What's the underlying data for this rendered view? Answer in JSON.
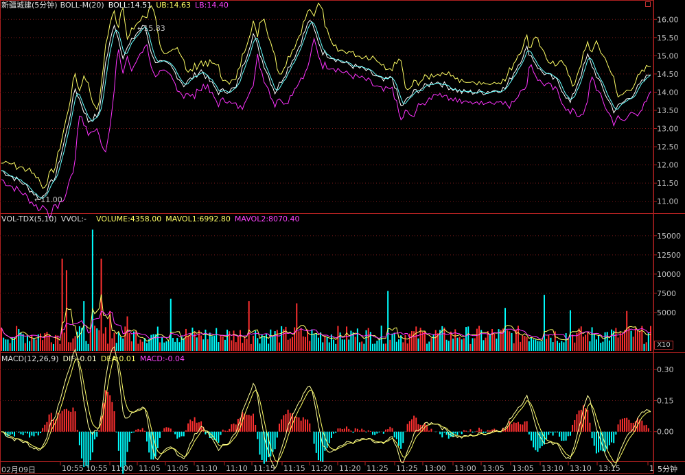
{
  "colors": {
    "bg": "#000000",
    "frame": "#b02020",
    "grid": "#7a1a1a",
    "price": "#ffffff",
    "boll_mid": "#ffffff",
    "ub": "#ffff66",
    "lb": "#ff33ff",
    "ma": "#66ffff",
    "up": "#ff3030",
    "down": "#00ffff",
    "vol_ma1": "#ffff66",
    "vol_ma2": "#ff33ff",
    "dif": "#ffff99",
    "text": "#c0c0c0"
  },
  "main_panel": {
    "title": "新疆城建(5分钟)",
    "indicator": "BOLL-M(20)",
    "boll": "BOLL:14.51",
    "ub": "UB:14.63",
    "lb": "LB:14.40",
    "y_ticks": [
      "16.00",
      "15.50",
      "15.00",
      "14.50",
      "14.00",
      "13.50",
      "13.00",
      "12.50",
      "12.00",
      "11.50",
      "11.00"
    ],
    "annotation_high": "15.83",
    "annotation_low": "11.00"
  },
  "vol_panel": {
    "title": "VOL-TDX(5,10)",
    "vvol": "VVOL:-",
    "volume": "VOLUME:4358.00",
    "mavol1": "MAVOL1:6992.80",
    "mavol2": "MAVOL2:8070.40",
    "y_ticks": [
      "15000",
      "12500",
      "10000",
      "7500",
      "5000"
    ],
    "unit": "X10"
  },
  "macd_panel": {
    "title": "MACD(12,26,9)",
    "dif": "DIF:-0.01",
    "dea": "DEA:0.01",
    "macd": "MACD:-0.04",
    "y_ticks": [
      "0.30",
      "0.15",
      "0.00"
    ]
  },
  "x_axis": {
    "date": "02月09日",
    "labels": [
      "10:55",
      "10:55",
      "11:00",
      "11:05",
      "11:05",
      "11:10",
      "11:10",
      "11:15",
      "11:15",
      "11:20",
      "11:20",
      "11:25",
      "11:25",
      "13:00",
      "13:00",
      "13:05",
      "13:05",
      "13:10",
      "13:10",
      "13:15",
      "1"
    ],
    "period": "5分钟"
  }
}
